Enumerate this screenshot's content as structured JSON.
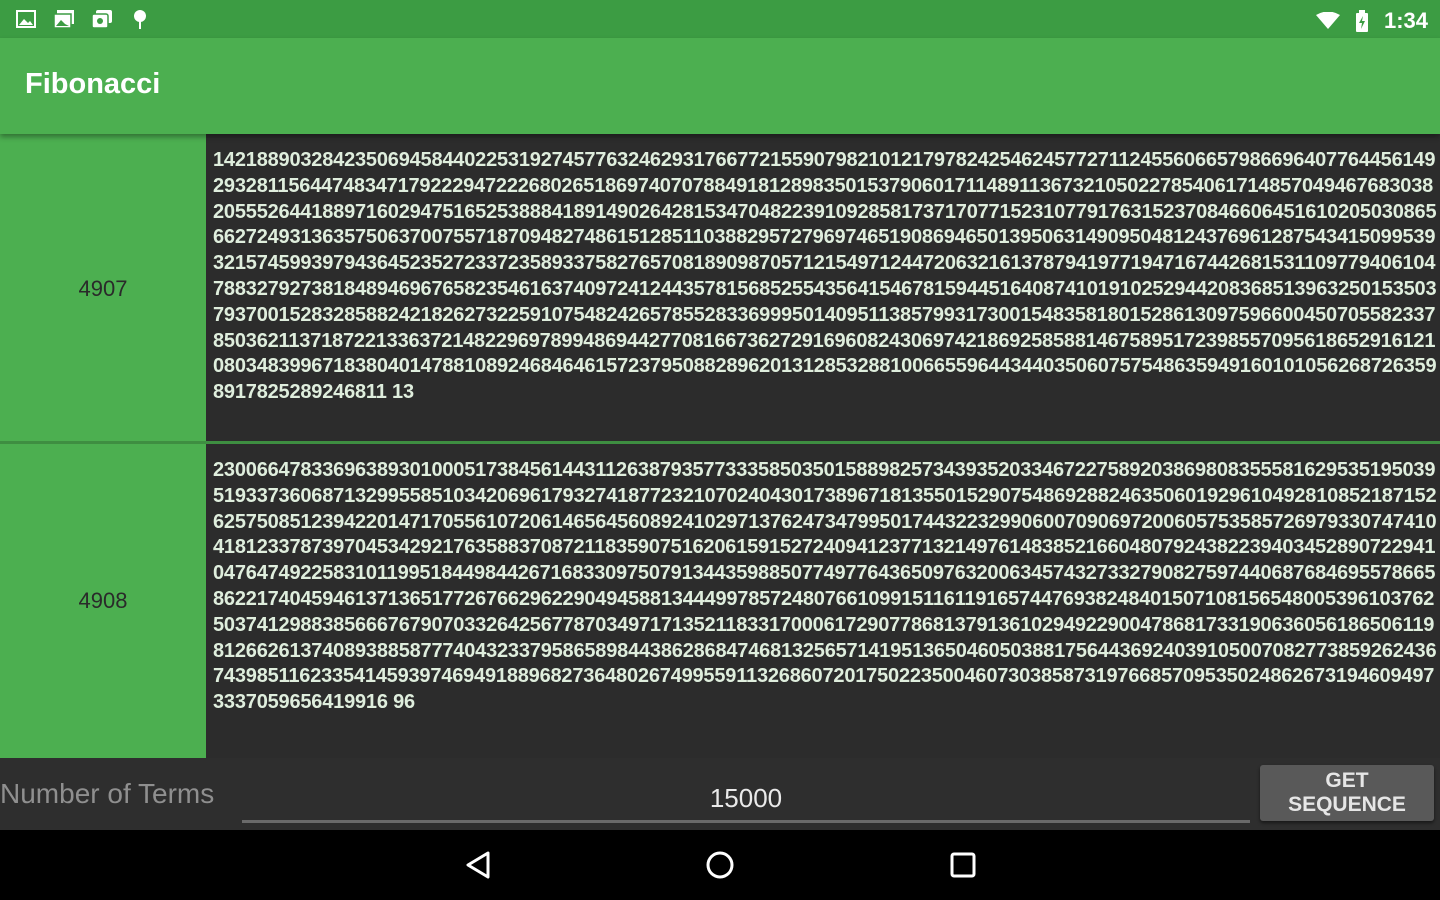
{
  "status_bar": {
    "time": "1:34",
    "left_icons": [
      "image-icon",
      "gallery-icon",
      "photos-icon",
      "pin-icon"
    ],
    "right_icons": [
      "wifi-icon",
      "battery-icon"
    ]
  },
  "app_bar": {
    "title": "Fibonacci"
  },
  "rows": [
    {
      "index": "4907",
      "value": "1421889032842350694584402253192745776324629317667721559079821012179782425462457727112455606657986696407764456149293281156447483471792229472226802651869740707884918128983501537906017114891136732105022785406171485704946768303820555264418897160294751652538884189149026428153470482239109285817371707715231077917631523708466064516102050308656627249313635750637007557187094827486151285110388295727969746519086946501395063149095048124376961287543415099539321574599397943645235272337235893375827657081890987057121549712447206321613787941977194716744268153110977940610478832792738184894696765823546163740972412443578156852554356415467815944516408741019102529442083685139632501535037937001528328588242182627322591075482426578552833699950140951138579931730015483581801528613097596600450705582337850362113718722133637214822969789948694427708166736272916960824306974218692585881467589517239855709561865291612108034839967183804014788108924684646157237950882896201312853288100665596443440350607575486359491601010562687263598917825289246811 13"
    },
    {
      "index": "4908",
      "value": "2300664783369638930100051738456144311263879357733358503501588982573439352033467227589203869808355581629535195039519337360687132995585103420696179327418772321070240430173896718135501529075486928824635060192961049281085218715262575085123942201471705561072061465645608924102971376247347995017443223299060070906972006057535857269793307474104181233787397045342921763588370872118359075162061591527240941237713214976148385216604807924382239403452890722941047647492258310119951844984426716833097507913443598850774977643650976320063457432733279082759744068768469557866586221740459461371365177267662962290494588134449978572480766109915116119165744769382484015071081565480053961037625037412988385666767907033264256778703497171352118331700061729077868137913610294922900478681733190636056186506119812662613740893885877740432337958658984438628684746813256571419513650460503881756443692403910500708277385926243674398511623354145939746949188968273648026749955911326860720175022350046073038587319766857095350248626731946094973337059656419916 96"
    }
  ],
  "bottom_panel": {
    "label": "Number of Terms",
    "input_value": "15000",
    "button_label": "GET SEQUENCE"
  },
  "nav_bar": {
    "icons": [
      "back-icon",
      "home-icon",
      "recents-icon"
    ]
  }
}
